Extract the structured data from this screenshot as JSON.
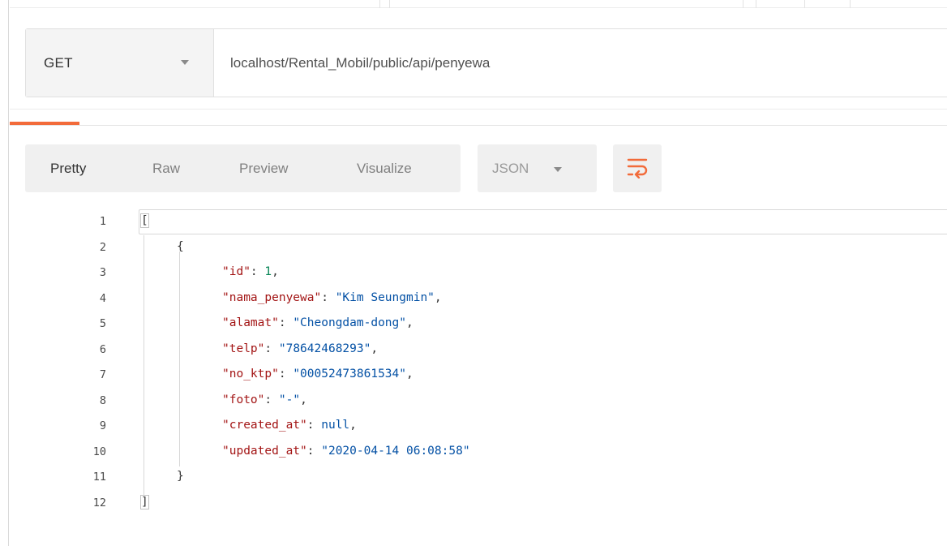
{
  "request": {
    "method": "GET",
    "url": "localhost/Rental_Mobil/public/api/penyewa"
  },
  "view_tabs": [
    {
      "label": "Pretty",
      "active": true
    },
    {
      "label": "Raw",
      "active": false
    },
    {
      "label": "Preview",
      "active": false
    },
    {
      "label": "Visualize",
      "active": false
    }
  ],
  "format": {
    "selected": "JSON"
  },
  "icons": {
    "method_caret": "chevron-down-icon",
    "format_caret": "chevron-down-icon",
    "wrap": "wrap-lines-icon"
  },
  "colors": {
    "accent": "#f26b3a",
    "key": "#a31515",
    "string": "#0451a5",
    "number": "#098658"
  },
  "response": {
    "line_numbers": [
      "1",
      "2",
      "3",
      "4",
      "5",
      "6",
      "7",
      "8",
      "9",
      "10",
      "11",
      "12"
    ],
    "open_bracket": "[",
    "open_brace": "{",
    "fields": [
      {
        "key": "\"id\"",
        "sep": ": ",
        "value": "1",
        "type": "number",
        "comma": ","
      },
      {
        "key": "\"nama_penyewa\"",
        "sep": ": ",
        "value": "\"Kim Seungmin\"",
        "type": "string",
        "comma": ","
      },
      {
        "key": "\"alamat\"",
        "sep": ": ",
        "value": "\"Cheongdam-dong\"",
        "type": "string",
        "comma": ","
      },
      {
        "key": "\"telp\"",
        "sep": ": ",
        "value": "\"78642468293\"",
        "type": "string",
        "comma": ","
      },
      {
        "key": "\"no_ktp\"",
        "sep": ": ",
        "value": "\"00052473861534\"",
        "type": "string",
        "comma": ","
      },
      {
        "key": "\"foto\"",
        "sep": ": ",
        "value": "\"-\"",
        "type": "string",
        "comma": ","
      },
      {
        "key": "\"created_at\"",
        "sep": ": ",
        "value": "null",
        "type": "keyword",
        "comma": ","
      },
      {
        "key": "\"updated_at\"",
        "sep": ": ",
        "value": "\"2020-04-14 06:08:58\"",
        "type": "string",
        "comma": ""
      }
    ],
    "close_brace": "}",
    "close_bracket": "]"
  }
}
